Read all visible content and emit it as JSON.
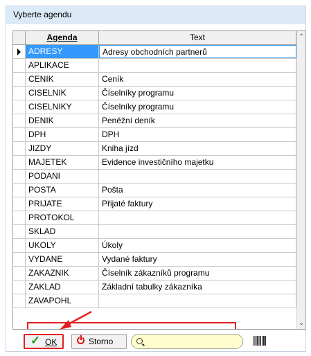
{
  "window": {
    "title": "Vyberte agendu"
  },
  "grid": {
    "headers": {
      "agenda": "Agenda",
      "text": "Text"
    },
    "selected_row": 0,
    "rows": [
      {
        "agenda": "ADRESY",
        "text": "Adresy obchodních partnerů"
      },
      {
        "agenda": "APLIKACE",
        "text": ""
      },
      {
        "agenda": "CENIK",
        "text": "Ceník"
      },
      {
        "agenda": "CISELNIK",
        "text": "Číselníky programu"
      },
      {
        "agenda": "CISELNIKY",
        "text": "Číselníky programu"
      },
      {
        "agenda": "DENIK",
        "text": "Peněžní deník"
      },
      {
        "agenda": "DPH",
        "text": "DPH"
      },
      {
        "agenda": "JIZDY",
        "text": "Kniha jízd"
      },
      {
        "agenda": "MAJETEK",
        "text": "Evidence investičního majetku"
      },
      {
        "agenda": "PODANI",
        "text": ""
      },
      {
        "agenda": "POSTA",
        "text": "Pošta"
      },
      {
        "agenda": "PRIJATE",
        "text": "Přijaté faktury"
      },
      {
        "agenda": "PROTOKOL",
        "text": ""
      },
      {
        "agenda": "SKLAD",
        "text": ""
      },
      {
        "agenda": "UKOLY",
        "text": "Úkoly"
      },
      {
        "agenda": "VYDANE",
        "text": "Vydané faktury"
      },
      {
        "agenda": "ZAKAZNIK",
        "text": "Číselník zákazníků programu"
      },
      {
        "agenda": "ZAKLAD",
        "text": "Základní tabulky zákazníka"
      },
      {
        "agenda": "ZAVAPOHL",
        "text": ""
      }
    ]
  },
  "toolbar": {
    "ok_label": "OK",
    "storno_label": "Storno",
    "search_value": ""
  },
  "colors": {
    "selection": "#3399ff",
    "annotation": "#e02020",
    "search_bg": "#fffecc"
  },
  "icons": [
    "checkmark-icon",
    "power-icon",
    "search-icon",
    "barcode-icon",
    "scroll-up-icon",
    "scroll-down-icon"
  ]
}
